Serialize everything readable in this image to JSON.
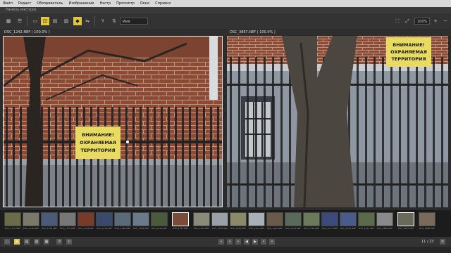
{
  "menu": [
    "Файл",
    "Редакт",
    "Обозреватель",
    "Изображение",
    "Настр",
    "Просмотр",
    "Окно",
    "Справка"
  ],
  "toolbar": {
    "title": "Панель инструм.",
    "sort_label": "Имя",
    "zoom_label": "100%"
  },
  "left_panel": {
    "title": "DSC_1242.NEF ( 100.0% )"
  },
  "right_panel": {
    "title": "DSC_3887.NEF ( 100.0% )"
  },
  "sign": {
    "line1": "ВНИМАНИЕ!",
    "line2": "ОХРАНЯЕМАЯ",
    "line3": "ТЕРРИТОРИЯ"
  },
  "filmstrip": {
    "items": [
      {
        "name": "DSC_1131.NEF",
        "color": "#6b6b4a"
      },
      {
        "name": "DSC_1140.NEF",
        "color": "#7a7a6a"
      },
      {
        "name": "DSC_1163.NEF",
        "color": "#4b5a7a"
      },
      {
        "name": "DSC_1175.NEF",
        "color": "#777"
      },
      {
        "name": "DSC_1178.NEF",
        "color": "#7a3a2a"
      },
      {
        "name": "DSC_1179.NEF",
        "color": "#3a4a6a"
      },
      {
        "name": "DSC_1180.NEF",
        "color": "#5a6a7a"
      },
      {
        "name": "DSC_1189.NEF",
        "color": "#6a7a8a"
      },
      {
        "name": "DSC_1228.NEF",
        "color": "#4a5a3a"
      },
      {
        "name": "DSC_1242.NEF",
        "color": "#7a4a3a"
      },
      {
        "name": "DSC_1243.NEF",
        "color": "#8a8a7a"
      },
      {
        "name": "DSC_1244.NEF",
        "color": "#9aa0a8"
      },
      {
        "name": "DSC_1245.NEF",
        "color": "#8a8a6a"
      },
      {
        "name": "DSC_1247.NEF",
        "color": "#aab0b8"
      },
      {
        "name": "DSC_1261.NEF",
        "color": "#6a5a4a"
      },
      {
        "name": "DSC_1263.NEF",
        "color": "#5a6a5a"
      },
      {
        "name": "DSC_2764.NEF",
        "color": "#6a7a5a"
      },
      {
        "name": "DSC_2774.NEF",
        "color": "#3a4a7a"
      },
      {
        "name": "DSC_2781.NEF",
        "color": "#4a5a8a"
      },
      {
        "name": "DSC_2791.NEF",
        "color": "#5a6a4a"
      },
      {
        "name": "DSC_3886.NEF",
        "color": "#8a8a8a"
      },
      {
        "name": "DSC_3887.NEF",
        "color": "#6a6a5a"
      },
      {
        "name": "DSC_3888.NEF",
        "color": "#7a6a5a"
      }
    ]
  },
  "status": {
    "counter": "11 / 23"
  }
}
